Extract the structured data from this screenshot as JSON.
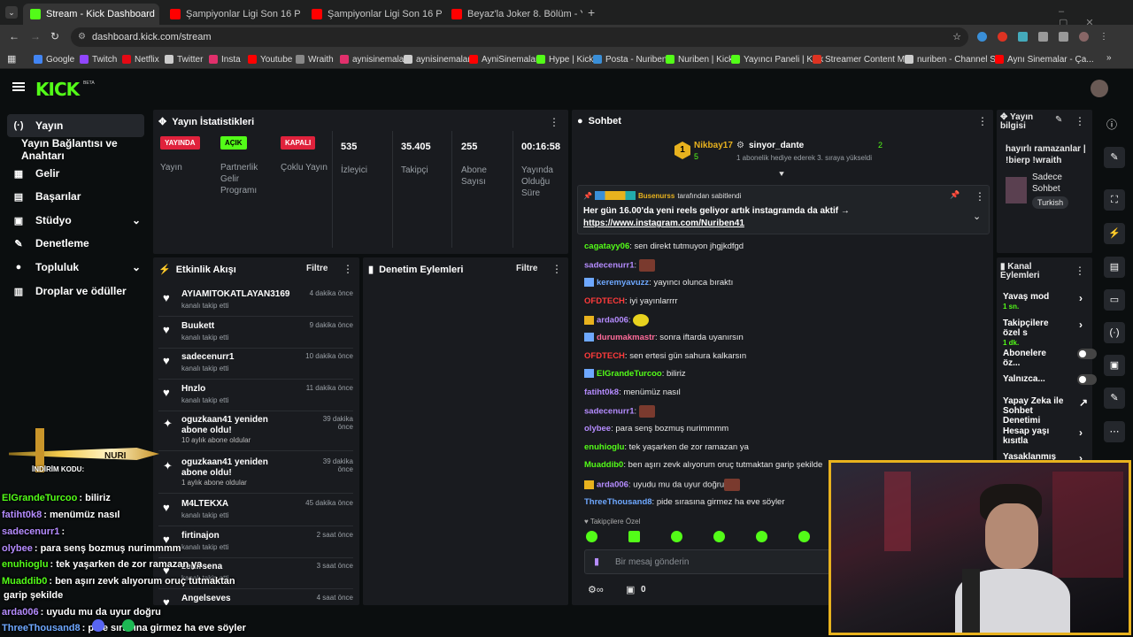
{
  "browser": {
    "tabs": [
      {
        "title": "Stream - Kick Dashboard",
        "color": "#53fc18"
      },
      {
        "title": "Şampiyonlar Ligi Son 16 Play-o",
        "color": "#ff0000"
      },
      {
        "title": "Şampiyonlar Ligi Son 16 Play-o",
        "color": "#ff0000"
      },
      {
        "title": "Beyaz'la Joker 8. Bölüm - YouTu",
        "color": "#ff0000"
      }
    ],
    "url": "dashboard.kick.com/stream",
    "bookmarks": [
      "Google",
      "Twitch",
      "Netflix",
      "Twitter",
      "Insta",
      "Youtube",
      "Wraith",
      "aynisinemalar",
      "aynisinemalar",
      "AyniSinemalar",
      "Hype | Kick",
      "Posta - Nuriben",
      "Nuriben | Kick",
      "Yayıncı Paneli | Kick",
      "Streamer Content M...",
      "nuriben - Channel S...",
      "Aynı Sinemalar - Ça..."
    ]
  },
  "header": {
    "logo": "KICK",
    "beta": "BETA"
  },
  "sidebar": {
    "items": [
      {
        "label": "Yayın",
        "icon": "(·)"
      },
      {
        "label": "Yayın Bağlantısı ve Anahtarı",
        "icon": ""
      },
      {
        "label": "Gelir",
        "icon": "▦"
      },
      {
        "label": "Başarılar",
        "icon": "▤"
      },
      {
        "label": "Stüdyo",
        "icon": "▣"
      },
      {
        "label": "Denetleme",
        "icon": "🔧"
      },
      {
        "label": "Topluluk",
        "icon": "👤"
      },
      {
        "label": "Droplar ve ödüller",
        "icon": "▥"
      }
    ]
  },
  "stats": {
    "title": "Yayın İstatistikleri",
    "yayin_badge": "YAYINDA",
    "yayin_label": "Yayın",
    "partner_badge": "AÇIK",
    "partner_label": "Partnerlik Gelir Programı",
    "coklu_badge": "KAPALI",
    "coklu_label": "Çoklu Yayın",
    "viewers": "535",
    "viewers_label": "İzleyici",
    "followers": "35.405",
    "followers_label": "Takipçi",
    "subs": "255",
    "subs_label": "Abone Sayısı",
    "duration": "00:16:58",
    "duration_label": "Yayında Olduğu Süre"
  },
  "activity": {
    "title": "Etkinlik Akışı",
    "filter": "Filtre",
    "events": [
      {
        "name": "AYIAMITOKATLAYAN3169",
        "sub": "kanalı takip etti",
        "time": "4 dakika önce"
      },
      {
        "name": "Buukett",
        "sub": "kanalı takip etti",
        "time": "9 dakika önce"
      },
      {
        "name": "sadecenurr1",
        "sub": "kanalı takip etti",
        "time": "10 dakika önce"
      },
      {
        "name": "Hnzlo",
        "sub": "kanalı takip etti",
        "time": "11 dakika önce"
      },
      {
        "name": "oguzkaan41 yeniden abone oldu!",
        "sub": "10 aylık abone oldular",
        "time": "39 dakika önce"
      },
      {
        "name": "oguzkaan41 yeniden abone oldu!",
        "sub": "1 aylık abone oldular",
        "time": "39 dakika önce"
      },
      {
        "name": "M4LTEKXA",
        "sub": "kanalı takip etti",
        "time": "45 dakika önce"
      },
      {
        "name": "firtinajon",
        "sub": "kanalı takip etti",
        "time": "2 saat önce"
      },
      {
        "name": "zehirsena",
        "sub": "kanalı takip etti",
        "time": "3 saat önce"
      },
      {
        "name": "Angelseves",
        "sub": "",
        "time": "4 saat önce"
      }
    ]
  },
  "moderation": {
    "title": "Denetim Eylemleri",
    "filter": "Filtre"
  },
  "chat": {
    "title": "Sohbet",
    "gift_from": "Nikbay17",
    "gift_from_count": "5",
    "gift_to": "sinyor_dante",
    "gift_to_count": "2",
    "gift_text": "1 abonelik hediye ederek 3. sıraya yükseldi",
    "pinned_by": "Busenurss",
    "pinned_suffix": "tarafından sabitlendi",
    "pinned_text": "Her gün 16.00'da yeni reels geliyor artık instagramda da aktif →",
    "pinned_link": "https://www.instagram.com/Nuriben41",
    "messages": [
      {
        "user": "cagatayy06",
        "color": "#53fc18",
        "text": "sen direkt tutmuyon jhgjkdfgd"
      },
      {
        "user": "sadecenurr1",
        "color": "#b58cff",
        "text": ""
      },
      {
        "user": "keremyavuzz",
        "color": "#6ea8ff",
        "text": "yayıncı olunca bıraktı"
      },
      {
        "user": "OFDTECH",
        "color": "#ff3b3b",
        "text": "iyi yayınlarrrr"
      },
      {
        "user": "arda006",
        "color": "#b58cff",
        "text": ""
      },
      {
        "user": "durumakmastr",
        "color": "#ff6b9a",
        "text": "sonra iftarda uyanırsın"
      },
      {
        "user": "OFDTECH",
        "color": "#ff3b3b",
        "text": "sen ertesi gün sahura kalkarsın"
      },
      {
        "user": "ElGrandeTurcoo",
        "color": "#53fc18",
        "text": "biliriz"
      },
      {
        "user": "fatiht0k8",
        "color": "#b58cff",
        "text": "menümüz nasıl"
      },
      {
        "user": "sadecenurr1",
        "color": "#b58cff",
        "text": ""
      },
      {
        "user": "olybee",
        "color": "#b58cff",
        "text": "para senş bozmuş nurimmmm"
      },
      {
        "user": "enuhioglu",
        "color": "#53fc18",
        "text": "tek yaşarken de zor ramazan ya"
      },
      {
        "user": "Muaddib0",
        "color": "#53fc18",
        "text": "ben aşırı zevk alıyorum oruç tutmaktan garip şekilde"
      },
      {
        "user": "arda006",
        "color": "#b58cff",
        "text": "uyudu mu da uyur doğru"
      },
      {
        "user": "ThreeThousand8",
        "color": "#6ea8ff",
        "text": "pide sırasına girmez ha eve söyler"
      }
    ],
    "followers_only": "Takipçilere Özel",
    "placeholder": "Bir mesaj gönderin",
    "count": "0"
  },
  "stream_info": {
    "title": "Yayın bilgisi",
    "desc": "hayırlı ramazanlar | !bierp !wraith",
    "mode": "Sadece Sohbet",
    "lang": "Turkish"
  },
  "channel_actions": {
    "title": "Kanal Eylemleri",
    "items": [
      {
        "label": "Yavaş mod",
        "sub": "1 sn."
      },
      {
        "label": "Takipçilere özel s",
        "sub": "1 dk."
      },
      {
        "label": "Abonelere öz...",
        "sub": ""
      },
      {
        "label": "Yalnızca...",
        "sub": ""
      },
      {
        "label": "Yapay Zeka ile Sohbet Denetimi",
        "sub": ""
      },
      {
        "label": "Hesap yaşı kısıtla",
        "sub": ""
      },
      {
        "label": "Yasaklanmış kelin",
        "sub": ""
      }
    ]
  },
  "overlay": {
    "promo_label": "İNDİRİM KODU:",
    "promo_brand": "NURI",
    "lines": [
      {
        "user": "ElGrandeTurcoo",
        "color": "#53fc18",
        "text": ": biliriz"
      },
      {
        "user": "fatiht0k8",
        "color": "#b58cff",
        "text": ": menümüz nasıl"
      },
      {
        "user": "sadecenurr1",
        "color": "#b58cff",
        "text": ":"
      },
      {
        "user": "olybee",
        "color": "#b58cff",
        "text": ": para senş bozmuş nurimmmm"
      },
      {
        "user": "enuhioglu",
        "color": "#53fc18",
        "text": ": tek yaşarken de zor ramazan ya"
      },
      {
        "user": "Muaddib0",
        "color": "#53fc18",
        "text": ": ben aşırı zevk alıyorum oruç tutmaktan"
      },
      {
        "user": "",
        "color": "#fff",
        "text": "garip şekilde"
      },
      {
        "user": "arda006",
        "color": "#b58cff",
        "text": ": uyudu mu da uyur doğru"
      },
      {
        "user": "ThreeThousand8",
        "color": "#6ea8ff",
        "text": ": pide sırasına girmez ha eve söyler"
      }
    ]
  }
}
